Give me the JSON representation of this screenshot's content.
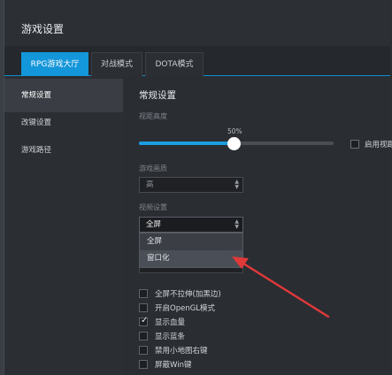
{
  "window": {
    "title": "游戏设置"
  },
  "tabs": [
    {
      "label": "RPG游戏大厅",
      "active": true
    },
    {
      "label": "对战模式",
      "active": false
    },
    {
      "label": "DOTA模式",
      "active": false
    }
  ],
  "sidebar": {
    "items": [
      {
        "label": "常规设置",
        "active": true
      },
      {
        "label": "改键设置",
        "active": false
      },
      {
        "label": "游戏路径",
        "active": false
      }
    ]
  },
  "main": {
    "section_title": "常规设置",
    "brightness": {
      "label": "视距高度",
      "value_text": "50%",
      "value": 0.5
    },
    "widescreen": {
      "label": "启用视距",
      "checked": false
    },
    "graphics": {
      "label": "游戏画质",
      "selected": "高"
    },
    "display_mode": {
      "label": "视频设置",
      "selected": "全屏",
      "options": [
        "全屏",
        "窗口化"
      ]
    },
    "checkboxes": [
      {
        "label": "全屏不拉伸(加黑边)",
        "checked": false
      },
      {
        "label": "开启OpenGL模式",
        "checked": false
      },
      {
        "label": "显示血量",
        "checked": true
      },
      {
        "label": "显示蓝条",
        "checked": false
      },
      {
        "label": "禁用小地图右键",
        "checked": false
      },
      {
        "label": "屏蔽Win键",
        "checked": false
      }
    ]
  },
  "colors": {
    "accent": "#1396da",
    "annotation_arrow": "#e0393a"
  },
  "icons": {
    "select_arrows": "up-down-chevron-icon",
    "check": "checkmark-icon"
  }
}
